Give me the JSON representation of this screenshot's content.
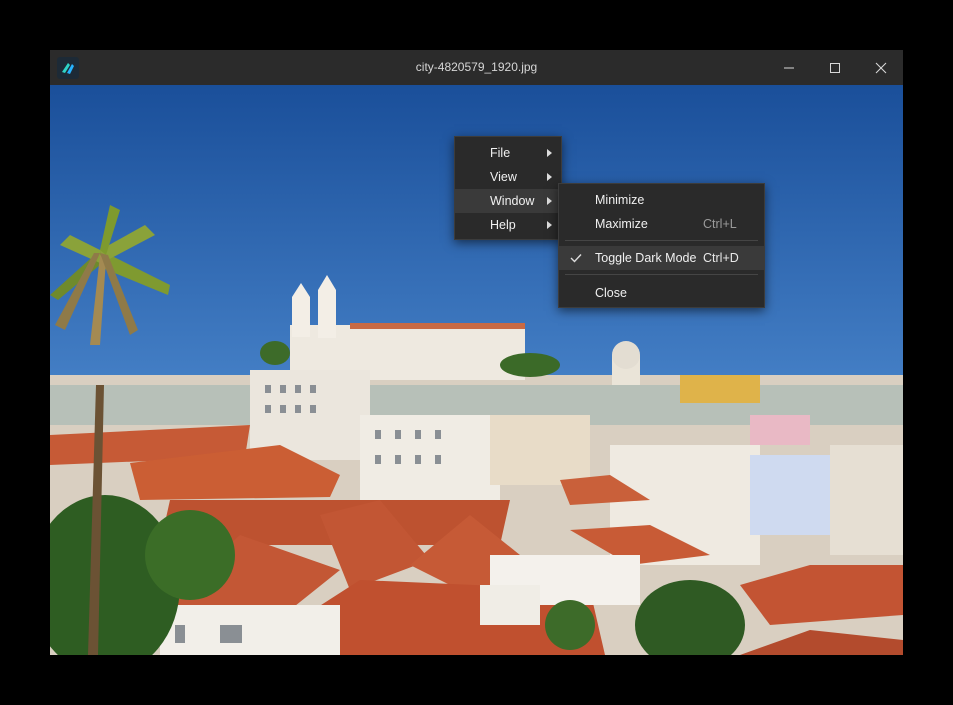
{
  "window": {
    "title": "city-4820579_1920.jpg",
    "icon": "app-logo-icon",
    "controls": [
      "minimize-icon",
      "maximize-icon",
      "close-icon"
    ]
  },
  "context_menu": {
    "items": [
      {
        "label": "File",
        "has_submenu": true
      },
      {
        "label": "View",
        "has_submenu": true
      },
      {
        "label": "Window",
        "has_submenu": true,
        "active": true
      },
      {
        "label": "Help",
        "has_submenu": true
      }
    ]
  },
  "window_submenu": {
    "items": [
      {
        "label": "Minimize",
        "shortcut": ""
      },
      {
        "label": "Maximize",
        "shortcut": "Ctrl+L"
      },
      {
        "label": "Toggle Dark Mode",
        "shortcut": "Ctrl+D",
        "checked": true
      },
      {
        "label": "Close",
        "shortcut": ""
      }
    ]
  },
  "image": {
    "description_icon": "city-photo",
    "colors": {
      "sky_top": "#1a4f9a",
      "sky_bottom": "#6aa2d8",
      "roof": "#c65a36",
      "walls": "#e9e4da"
    }
  }
}
